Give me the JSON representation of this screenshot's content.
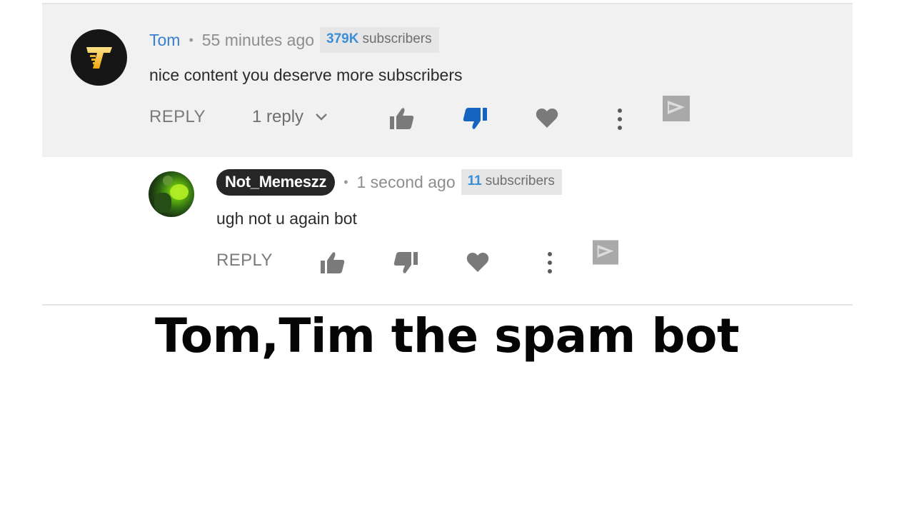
{
  "comment": {
    "author": "Tom",
    "time": "55 minutes ago",
    "subscriber_count": "379K",
    "subscriber_label": "subscribers",
    "text": "nice content you deserve more subscribers",
    "reply_label": "REPLY",
    "replies_toggle": "1 reply",
    "disliked": true
  },
  "reply": {
    "author": "Not_Memeszz",
    "time": "1 second ago",
    "subscriber_count": "11",
    "subscriber_label": "subscribers",
    "text": "ugh not u again bot",
    "reply_label": "REPLY"
  },
  "separator": "•",
  "caption": "Tom,Tim the spam bot",
  "icons": {
    "like": "thumbs-up-icon",
    "dislike": "thumbs-down-icon",
    "heart": "heart-icon",
    "more": "vertical-dots-icon",
    "extension": "extension-flag-icon",
    "expand": "chevron-down-icon"
  },
  "colors": {
    "author_link": "#3a7fce",
    "dislike_active": "#1565c0",
    "icon_gray": "#7a7a7a",
    "comment_background": "#f1f1f1"
  }
}
